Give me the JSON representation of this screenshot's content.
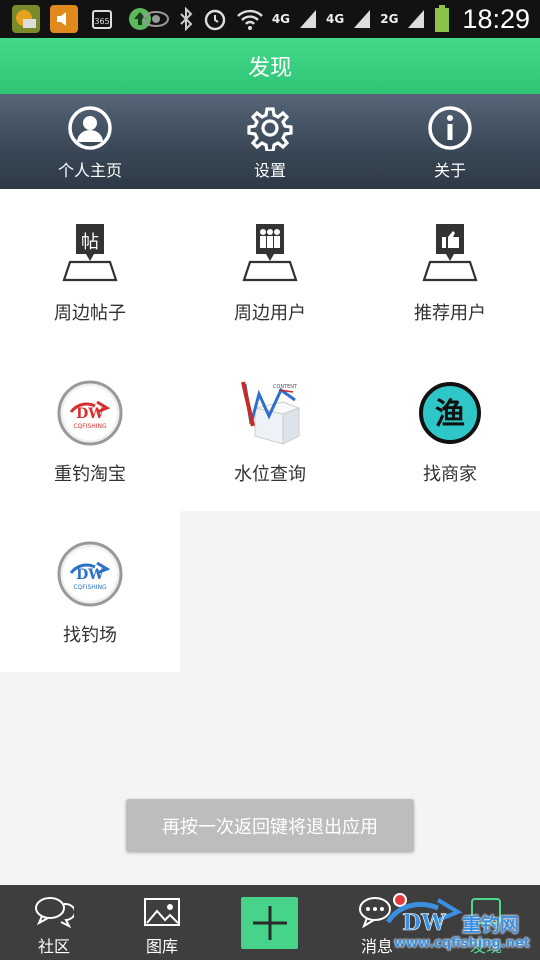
{
  "status_bar": {
    "network_labels": [
      "4G",
      "4G",
      "2G"
    ],
    "time": "18:29"
  },
  "title_bar": {
    "title": "发现"
  },
  "top_nav": {
    "items": [
      {
        "label": "个人主页",
        "icon": "person-circle-icon"
      },
      {
        "label": "设置",
        "icon": "gear-icon"
      },
      {
        "label": "关于",
        "icon": "info-icon"
      }
    ]
  },
  "grid": {
    "items": [
      {
        "label": "周边帖子",
        "icon": "nearby-posts-icon"
      },
      {
        "label": "周边用户",
        "icon": "nearby-users-icon"
      },
      {
        "label": "推荐用户",
        "icon": "recommend-users-icon"
      },
      {
        "label": "重钓淘宝",
        "icon": "cqfishing-logo-icon"
      },
      {
        "label": "水位查询",
        "icon": "water-level-chart-icon"
      },
      {
        "label": "找商家",
        "icon": "fish-merchant-icon"
      },
      {
        "label": "找钓场",
        "icon": "cqfishing-logo-icon"
      }
    ],
    "merchant_char": "渔"
  },
  "toast": {
    "text": "再按一次返回键将退出应用"
  },
  "bottom_nav": {
    "items": [
      {
        "label": "社区",
        "icon": "chat-bubbles-icon"
      },
      {
        "label": "图库",
        "icon": "image-icon"
      },
      {
        "label": "消息",
        "icon": "message-icon"
      },
      {
        "label": "发现",
        "icon": "discover-icon",
        "active": true
      }
    ]
  },
  "watermark": {
    "title": "重钓网",
    "url": "www.cqfishing.net"
  },
  "colors": {
    "accent": "#43d88a",
    "nav_dark": "#3b4958",
    "badge": "#e53b3b"
  }
}
